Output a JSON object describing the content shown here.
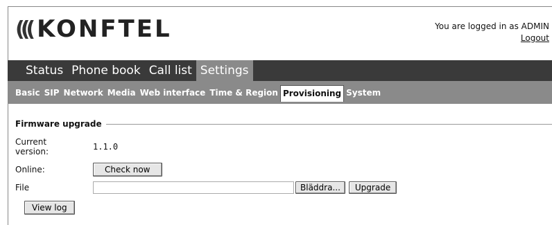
{
  "header": {
    "logo_waves": "((( ",
    "logo_text": "KONFTEL",
    "logged_in_text": "You are logged in as ADMIN",
    "logout_label": "Logout"
  },
  "main_tabs": [
    {
      "label": "Status",
      "active": false
    },
    {
      "label": "Phone book",
      "active": false
    },
    {
      "label": "Call list",
      "active": false
    },
    {
      "label": "Settings",
      "active": true
    }
  ],
  "sub_tabs": [
    {
      "label": "Basic",
      "active": false
    },
    {
      "label": "SIP",
      "active": false
    },
    {
      "label": "Network",
      "active": false
    },
    {
      "label": "Media",
      "active": false
    },
    {
      "label": "Web interface",
      "active": false
    },
    {
      "label": "Time & Region",
      "active": false
    },
    {
      "label": "Provisioning",
      "active": true
    },
    {
      "label": "System",
      "active": false
    }
  ],
  "firmware": {
    "section_title": "Firmware upgrade",
    "current_version_label": "Current version:",
    "current_version_value": "1.1.0",
    "online_label": "Online:",
    "check_now_label": "Check now",
    "file_label": "File",
    "file_value": "",
    "browse_label": "Bläddra...",
    "upgrade_label": "Upgrade",
    "view_log_label": "View log"
  }
}
